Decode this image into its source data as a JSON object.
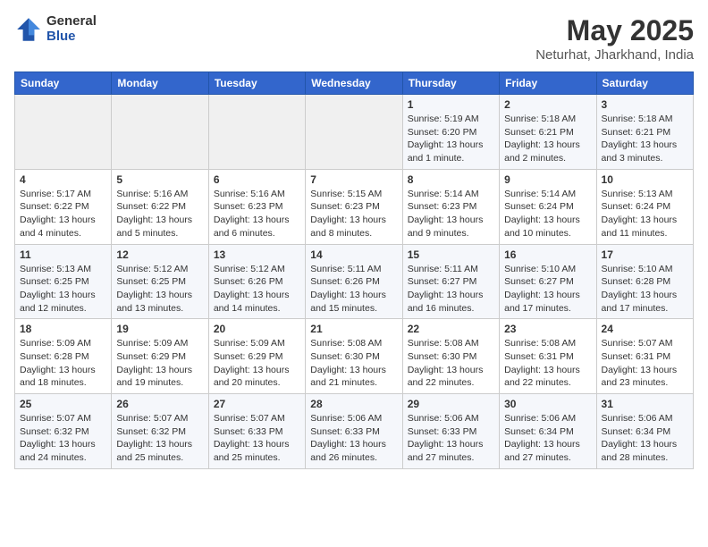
{
  "logo": {
    "general": "General",
    "blue": "Blue"
  },
  "title": "May 2025",
  "location": "Neturhat, Jharkhand, India",
  "headers": [
    "Sunday",
    "Monday",
    "Tuesday",
    "Wednesday",
    "Thursday",
    "Friday",
    "Saturday"
  ],
  "weeks": [
    [
      {
        "day": "",
        "info": ""
      },
      {
        "day": "",
        "info": ""
      },
      {
        "day": "",
        "info": ""
      },
      {
        "day": "",
        "info": ""
      },
      {
        "day": "1",
        "info": "Sunrise: 5:19 AM\nSunset: 6:20 PM\nDaylight: 13 hours and 1 minute."
      },
      {
        "day": "2",
        "info": "Sunrise: 5:18 AM\nSunset: 6:21 PM\nDaylight: 13 hours and 2 minutes."
      },
      {
        "day": "3",
        "info": "Sunrise: 5:18 AM\nSunset: 6:21 PM\nDaylight: 13 hours and 3 minutes."
      }
    ],
    [
      {
        "day": "4",
        "info": "Sunrise: 5:17 AM\nSunset: 6:22 PM\nDaylight: 13 hours and 4 minutes."
      },
      {
        "day": "5",
        "info": "Sunrise: 5:16 AM\nSunset: 6:22 PM\nDaylight: 13 hours and 5 minutes."
      },
      {
        "day": "6",
        "info": "Sunrise: 5:16 AM\nSunset: 6:23 PM\nDaylight: 13 hours and 6 minutes."
      },
      {
        "day": "7",
        "info": "Sunrise: 5:15 AM\nSunset: 6:23 PM\nDaylight: 13 hours and 8 minutes."
      },
      {
        "day": "8",
        "info": "Sunrise: 5:14 AM\nSunset: 6:23 PM\nDaylight: 13 hours and 9 minutes."
      },
      {
        "day": "9",
        "info": "Sunrise: 5:14 AM\nSunset: 6:24 PM\nDaylight: 13 hours and 10 minutes."
      },
      {
        "day": "10",
        "info": "Sunrise: 5:13 AM\nSunset: 6:24 PM\nDaylight: 13 hours and 11 minutes."
      }
    ],
    [
      {
        "day": "11",
        "info": "Sunrise: 5:13 AM\nSunset: 6:25 PM\nDaylight: 13 hours and 12 minutes."
      },
      {
        "day": "12",
        "info": "Sunrise: 5:12 AM\nSunset: 6:25 PM\nDaylight: 13 hours and 13 minutes."
      },
      {
        "day": "13",
        "info": "Sunrise: 5:12 AM\nSunset: 6:26 PM\nDaylight: 13 hours and 14 minutes."
      },
      {
        "day": "14",
        "info": "Sunrise: 5:11 AM\nSunset: 6:26 PM\nDaylight: 13 hours and 15 minutes."
      },
      {
        "day": "15",
        "info": "Sunrise: 5:11 AM\nSunset: 6:27 PM\nDaylight: 13 hours and 16 minutes."
      },
      {
        "day": "16",
        "info": "Sunrise: 5:10 AM\nSunset: 6:27 PM\nDaylight: 13 hours and 17 minutes."
      },
      {
        "day": "17",
        "info": "Sunrise: 5:10 AM\nSunset: 6:28 PM\nDaylight: 13 hours and 17 minutes."
      }
    ],
    [
      {
        "day": "18",
        "info": "Sunrise: 5:09 AM\nSunset: 6:28 PM\nDaylight: 13 hours and 18 minutes."
      },
      {
        "day": "19",
        "info": "Sunrise: 5:09 AM\nSunset: 6:29 PM\nDaylight: 13 hours and 19 minutes."
      },
      {
        "day": "20",
        "info": "Sunrise: 5:09 AM\nSunset: 6:29 PM\nDaylight: 13 hours and 20 minutes."
      },
      {
        "day": "21",
        "info": "Sunrise: 5:08 AM\nSunset: 6:30 PM\nDaylight: 13 hours and 21 minutes."
      },
      {
        "day": "22",
        "info": "Sunrise: 5:08 AM\nSunset: 6:30 PM\nDaylight: 13 hours and 22 minutes."
      },
      {
        "day": "23",
        "info": "Sunrise: 5:08 AM\nSunset: 6:31 PM\nDaylight: 13 hours and 22 minutes."
      },
      {
        "day": "24",
        "info": "Sunrise: 5:07 AM\nSunset: 6:31 PM\nDaylight: 13 hours and 23 minutes."
      }
    ],
    [
      {
        "day": "25",
        "info": "Sunrise: 5:07 AM\nSunset: 6:32 PM\nDaylight: 13 hours and 24 minutes."
      },
      {
        "day": "26",
        "info": "Sunrise: 5:07 AM\nSunset: 6:32 PM\nDaylight: 13 hours and 25 minutes."
      },
      {
        "day": "27",
        "info": "Sunrise: 5:07 AM\nSunset: 6:33 PM\nDaylight: 13 hours and 25 minutes."
      },
      {
        "day": "28",
        "info": "Sunrise: 5:06 AM\nSunset: 6:33 PM\nDaylight: 13 hours and 26 minutes."
      },
      {
        "day": "29",
        "info": "Sunrise: 5:06 AM\nSunset: 6:33 PM\nDaylight: 13 hours and 27 minutes."
      },
      {
        "day": "30",
        "info": "Sunrise: 5:06 AM\nSunset: 6:34 PM\nDaylight: 13 hours and 27 minutes."
      },
      {
        "day": "31",
        "info": "Sunrise: 5:06 AM\nSunset: 6:34 PM\nDaylight: 13 hours and 28 minutes."
      }
    ]
  ]
}
